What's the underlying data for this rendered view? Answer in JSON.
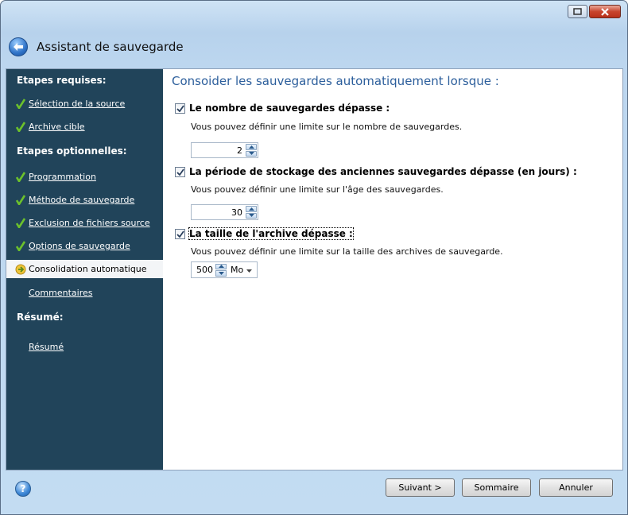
{
  "window": {
    "title": "Assistant de sauvegarde"
  },
  "sidebar": {
    "required_heading": "Etapes requises:",
    "required_items": [
      {
        "label": "Sélection de la source",
        "done": true
      },
      {
        "label": "Archive cible",
        "done": true
      }
    ],
    "optional_heading": "Etapes optionnelles:",
    "optional_items": [
      {
        "label": "Programmation",
        "done": true
      },
      {
        "label": "Méthode de sauvegarde",
        "done": true
      },
      {
        "label": "Exclusion de fichiers source",
        "done": true
      },
      {
        "label": "Options de sauvegarde",
        "done": true
      },
      {
        "label": "Consolidation automatique",
        "current": true
      },
      {
        "label": "Commentaires"
      }
    ],
    "summary_heading": "Résumé:",
    "summary_item": {
      "label": "Résumé"
    }
  },
  "main": {
    "title": "Consoider les sauvegardes automatiquement lorsque :",
    "options": [
      {
        "label": "Le nombre de sauvegardes dépasse :",
        "checked": true,
        "description": "Vous pouvez définir une limite sur le nombre de sauvegardes.",
        "value": "2"
      },
      {
        "label": "La période de stockage des anciennes sauvegardes dépasse (en jours) :",
        "checked": true,
        "description": "Vous pouvez définir une limite sur l'âge des sauvegardes.",
        "value": "30"
      },
      {
        "label": "La taille de l'archive dépasse :",
        "checked": true,
        "description": "Vous pouvez définir une limite sur la taille des archives de sauvegarde.",
        "value": "500",
        "unit": "Mo"
      }
    ]
  },
  "footer": {
    "next_label": "Suivant >",
    "summary_label": "Sommaire",
    "cancel_label": "Annuler"
  },
  "colors": {
    "sidebar_bg": "#21445a",
    "title_blue": "#2d5f9c",
    "check_green": "#6cc12b"
  }
}
